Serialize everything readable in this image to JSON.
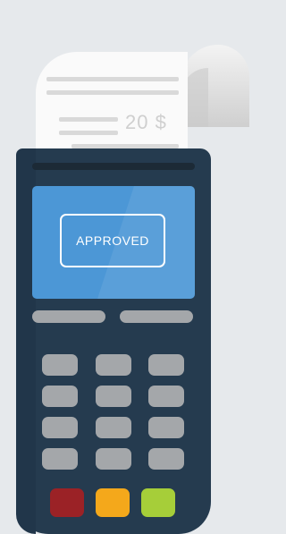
{
  "receipt": {
    "amount": "20 $"
  },
  "screen": {
    "status": "APPROVED"
  },
  "colors": {
    "background": "#e6e9ec",
    "terminal_body": "#253b4f",
    "screen": "#4c97d6",
    "keys": "#a4a7aa",
    "cancel_key": "#9b2226",
    "clear_key": "#f4a81b",
    "enter_key": "#a6ce39"
  },
  "keypad": {
    "function_keys": [
      "function-key-left",
      "function-key-right"
    ],
    "number_keys": 12,
    "command_keys": [
      "cancel",
      "clear",
      "enter"
    ]
  }
}
